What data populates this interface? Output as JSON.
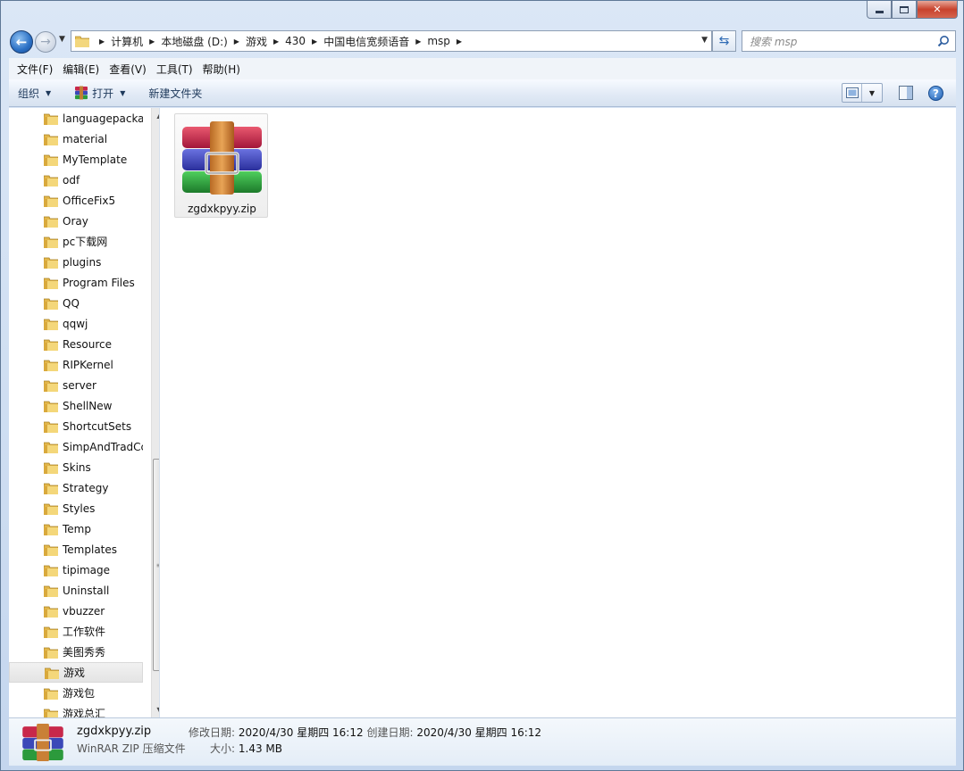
{
  "window": {
    "controls": [
      "minimize",
      "maximize",
      "close"
    ]
  },
  "address": {
    "crumbs": [
      "计算机",
      "本地磁盘 (D:)",
      "游戏",
      "430",
      "中国电信宽频语音",
      "msp"
    ]
  },
  "search": {
    "placeholder": "搜索 msp"
  },
  "menu": [
    "文件(F)",
    "编辑(E)",
    "查看(V)",
    "工具(T)",
    "帮助(H)"
  ],
  "toolbar": {
    "organize": "组织",
    "open": "打开",
    "new_folder": "新建文件夹"
  },
  "nav": {
    "items": [
      "languagepacka",
      "material",
      "MyTemplate",
      "odf",
      "OfficeFix5",
      "Oray",
      "pc下载网",
      "plugins",
      "Program Files",
      "QQ",
      "qqwj",
      "Resource",
      "RIPKernel",
      "server",
      "ShellNew",
      "ShortcutSets",
      "SimpAndTradCc",
      "Skins",
      "Strategy",
      "Styles",
      "Temp",
      "Templates",
      "tipimage",
      "Uninstall",
      "vbuzzer",
      "工作软件",
      "美图秀秀",
      "游戏",
      "游戏包",
      "游戏总汇"
    ],
    "selected": "游戏"
  },
  "files": [
    {
      "name": "zgdxkpyy.zip",
      "icon": "winrar-archive-icon"
    }
  ],
  "details": {
    "name": "zgdxkpyy.zip",
    "type": "WinRAR ZIP 压缩文件",
    "modified_label": "修改日期:",
    "modified": "2020/4/30 星期四 16:12",
    "created_label": "创建日期:",
    "created": "2020/4/30 星期四 16:12",
    "size_label": "大小:",
    "size": "1.43 MB"
  },
  "colors": {
    "frame": "#c4d6ee",
    "toolbar": "#e0e9f5",
    "selection": "#e4e4e4"
  }
}
